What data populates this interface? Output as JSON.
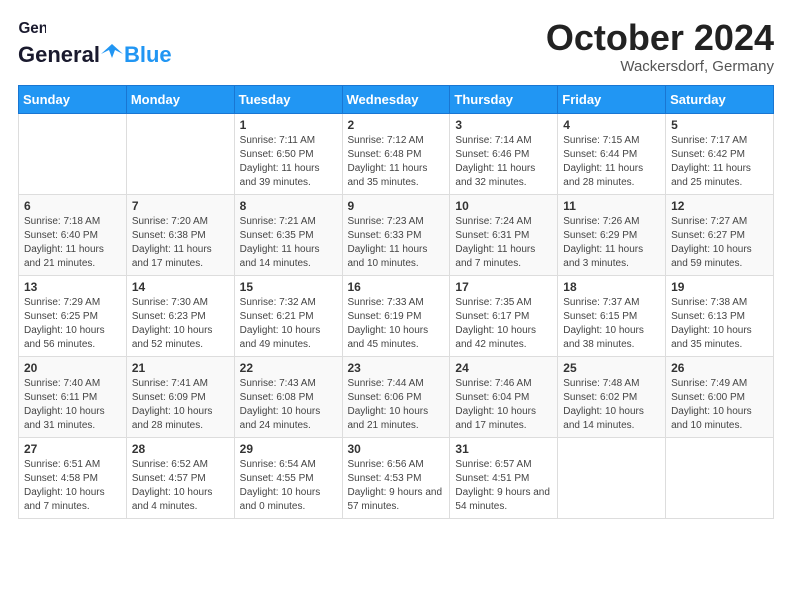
{
  "header": {
    "logo_general": "General",
    "logo_blue": "Blue",
    "month_title": "October 2024",
    "location": "Wackersdorf, Germany"
  },
  "days_of_week": [
    "Sunday",
    "Monday",
    "Tuesday",
    "Wednesday",
    "Thursday",
    "Friday",
    "Saturday"
  ],
  "weeks": [
    [
      {
        "day": "",
        "sunrise": "",
        "sunset": "",
        "daylight": ""
      },
      {
        "day": "",
        "sunrise": "",
        "sunset": "",
        "daylight": ""
      },
      {
        "day": "1",
        "sunrise": "Sunrise: 7:11 AM",
        "sunset": "Sunset: 6:50 PM",
        "daylight": "Daylight: 11 hours and 39 minutes."
      },
      {
        "day": "2",
        "sunrise": "Sunrise: 7:12 AM",
        "sunset": "Sunset: 6:48 PM",
        "daylight": "Daylight: 11 hours and 35 minutes."
      },
      {
        "day": "3",
        "sunrise": "Sunrise: 7:14 AM",
        "sunset": "Sunset: 6:46 PM",
        "daylight": "Daylight: 11 hours and 32 minutes."
      },
      {
        "day": "4",
        "sunrise": "Sunrise: 7:15 AM",
        "sunset": "Sunset: 6:44 PM",
        "daylight": "Daylight: 11 hours and 28 minutes."
      },
      {
        "day": "5",
        "sunrise": "Sunrise: 7:17 AM",
        "sunset": "Sunset: 6:42 PM",
        "daylight": "Daylight: 11 hours and 25 minutes."
      }
    ],
    [
      {
        "day": "6",
        "sunrise": "Sunrise: 7:18 AM",
        "sunset": "Sunset: 6:40 PM",
        "daylight": "Daylight: 11 hours and 21 minutes."
      },
      {
        "day": "7",
        "sunrise": "Sunrise: 7:20 AM",
        "sunset": "Sunset: 6:38 PM",
        "daylight": "Daylight: 11 hours and 17 minutes."
      },
      {
        "day": "8",
        "sunrise": "Sunrise: 7:21 AM",
        "sunset": "Sunset: 6:35 PM",
        "daylight": "Daylight: 11 hours and 14 minutes."
      },
      {
        "day": "9",
        "sunrise": "Sunrise: 7:23 AM",
        "sunset": "Sunset: 6:33 PM",
        "daylight": "Daylight: 11 hours and 10 minutes."
      },
      {
        "day": "10",
        "sunrise": "Sunrise: 7:24 AM",
        "sunset": "Sunset: 6:31 PM",
        "daylight": "Daylight: 11 hours and 7 minutes."
      },
      {
        "day": "11",
        "sunrise": "Sunrise: 7:26 AM",
        "sunset": "Sunset: 6:29 PM",
        "daylight": "Daylight: 11 hours and 3 minutes."
      },
      {
        "day": "12",
        "sunrise": "Sunrise: 7:27 AM",
        "sunset": "Sunset: 6:27 PM",
        "daylight": "Daylight: 10 hours and 59 minutes."
      }
    ],
    [
      {
        "day": "13",
        "sunrise": "Sunrise: 7:29 AM",
        "sunset": "Sunset: 6:25 PM",
        "daylight": "Daylight: 10 hours and 56 minutes."
      },
      {
        "day": "14",
        "sunrise": "Sunrise: 7:30 AM",
        "sunset": "Sunset: 6:23 PM",
        "daylight": "Daylight: 10 hours and 52 minutes."
      },
      {
        "day": "15",
        "sunrise": "Sunrise: 7:32 AM",
        "sunset": "Sunset: 6:21 PM",
        "daylight": "Daylight: 10 hours and 49 minutes."
      },
      {
        "day": "16",
        "sunrise": "Sunrise: 7:33 AM",
        "sunset": "Sunset: 6:19 PM",
        "daylight": "Daylight: 10 hours and 45 minutes."
      },
      {
        "day": "17",
        "sunrise": "Sunrise: 7:35 AM",
        "sunset": "Sunset: 6:17 PM",
        "daylight": "Daylight: 10 hours and 42 minutes."
      },
      {
        "day": "18",
        "sunrise": "Sunrise: 7:37 AM",
        "sunset": "Sunset: 6:15 PM",
        "daylight": "Daylight: 10 hours and 38 minutes."
      },
      {
        "day": "19",
        "sunrise": "Sunrise: 7:38 AM",
        "sunset": "Sunset: 6:13 PM",
        "daylight": "Daylight: 10 hours and 35 minutes."
      }
    ],
    [
      {
        "day": "20",
        "sunrise": "Sunrise: 7:40 AM",
        "sunset": "Sunset: 6:11 PM",
        "daylight": "Daylight: 10 hours and 31 minutes."
      },
      {
        "day": "21",
        "sunrise": "Sunrise: 7:41 AM",
        "sunset": "Sunset: 6:09 PM",
        "daylight": "Daylight: 10 hours and 28 minutes."
      },
      {
        "day": "22",
        "sunrise": "Sunrise: 7:43 AM",
        "sunset": "Sunset: 6:08 PM",
        "daylight": "Daylight: 10 hours and 24 minutes."
      },
      {
        "day": "23",
        "sunrise": "Sunrise: 7:44 AM",
        "sunset": "Sunset: 6:06 PM",
        "daylight": "Daylight: 10 hours and 21 minutes."
      },
      {
        "day": "24",
        "sunrise": "Sunrise: 7:46 AM",
        "sunset": "Sunset: 6:04 PM",
        "daylight": "Daylight: 10 hours and 17 minutes."
      },
      {
        "day": "25",
        "sunrise": "Sunrise: 7:48 AM",
        "sunset": "Sunset: 6:02 PM",
        "daylight": "Daylight: 10 hours and 14 minutes."
      },
      {
        "day": "26",
        "sunrise": "Sunrise: 7:49 AM",
        "sunset": "Sunset: 6:00 PM",
        "daylight": "Daylight: 10 hours and 10 minutes."
      }
    ],
    [
      {
        "day": "27",
        "sunrise": "Sunrise: 6:51 AM",
        "sunset": "Sunset: 4:58 PM",
        "daylight": "Daylight: 10 hours and 7 minutes."
      },
      {
        "day": "28",
        "sunrise": "Sunrise: 6:52 AM",
        "sunset": "Sunset: 4:57 PM",
        "daylight": "Daylight: 10 hours and 4 minutes."
      },
      {
        "day": "29",
        "sunrise": "Sunrise: 6:54 AM",
        "sunset": "Sunset: 4:55 PM",
        "daylight": "Daylight: 10 hours and 0 minutes."
      },
      {
        "day": "30",
        "sunrise": "Sunrise: 6:56 AM",
        "sunset": "Sunset: 4:53 PM",
        "daylight": "Daylight: 9 hours and 57 minutes."
      },
      {
        "day": "31",
        "sunrise": "Sunrise: 6:57 AM",
        "sunset": "Sunset: 4:51 PM",
        "daylight": "Daylight: 9 hours and 54 minutes."
      },
      {
        "day": "",
        "sunrise": "",
        "sunset": "",
        "daylight": ""
      },
      {
        "day": "",
        "sunrise": "",
        "sunset": "",
        "daylight": ""
      }
    ]
  ]
}
